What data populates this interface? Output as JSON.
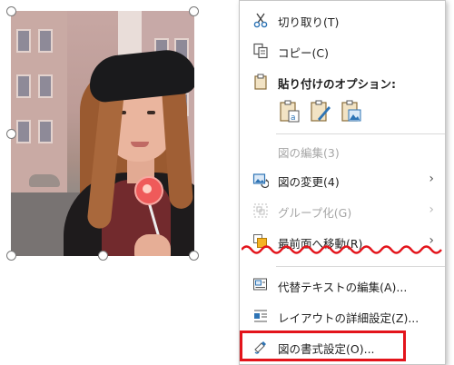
{
  "menu": {
    "cut": "切り取り(T)",
    "copy": "コピー(C)",
    "paste_options": "貼り付けのオプション:",
    "edit_picture": "図の編集(3)",
    "change_picture": "図の変更(4)",
    "group": "グループ化(G)",
    "bring_to_front": "最前面へ移動(R)",
    "edit_alt_text": "代替テキストの編集(A)...",
    "layout_options": "レイアウトの詳細設定(Z)...",
    "format_picture": "図の書式設定(O)..."
  },
  "icons": {
    "cut": "scissors-icon",
    "copy": "copy-icon",
    "paste": "clipboard-icon",
    "paste_keep_source": "paste-keep-source-formatting-icon",
    "paste_merge": "paste-merge-formatting-icon",
    "paste_picture": "paste-as-picture-icon",
    "edit_picture": "edit-picture-icon",
    "change_picture": "change-picture-icon",
    "group": "group-icon",
    "bring_to_front": "bring-to-front-icon",
    "alt_text": "alt-text-icon",
    "layout": "layout-options-icon",
    "format_picture": "format-picture-icon",
    "submenu_arrow": "chevron-right-icon"
  },
  "colors": {
    "annotation_red": "#e3141b",
    "icon_blue": "#2e74b5",
    "disabled_text": "#a6a6a6"
  }
}
